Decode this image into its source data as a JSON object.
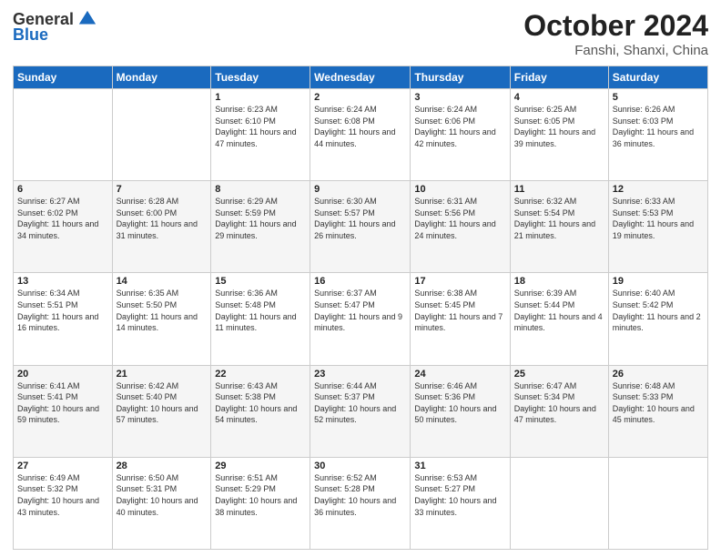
{
  "logo": {
    "general": "General",
    "blue": "Blue"
  },
  "header": {
    "title": "October 2024",
    "subtitle": "Fanshi, Shanxi, China"
  },
  "weekdays": [
    "Sunday",
    "Monday",
    "Tuesday",
    "Wednesday",
    "Thursday",
    "Friday",
    "Saturday"
  ],
  "weeks": [
    [
      null,
      null,
      {
        "day": "1",
        "sunrise": "Sunrise: 6:23 AM",
        "sunset": "Sunset: 6:10 PM",
        "daylight": "Daylight: 11 hours and 47 minutes."
      },
      {
        "day": "2",
        "sunrise": "Sunrise: 6:24 AM",
        "sunset": "Sunset: 6:08 PM",
        "daylight": "Daylight: 11 hours and 44 minutes."
      },
      {
        "day": "3",
        "sunrise": "Sunrise: 6:24 AM",
        "sunset": "Sunset: 6:06 PM",
        "daylight": "Daylight: 11 hours and 42 minutes."
      },
      {
        "day": "4",
        "sunrise": "Sunrise: 6:25 AM",
        "sunset": "Sunset: 6:05 PM",
        "daylight": "Daylight: 11 hours and 39 minutes."
      },
      {
        "day": "5",
        "sunrise": "Sunrise: 6:26 AM",
        "sunset": "Sunset: 6:03 PM",
        "daylight": "Daylight: 11 hours and 36 minutes."
      }
    ],
    [
      {
        "day": "6",
        "sunrise": "Sunrise: 6:27 AM",
        "sunset": "Sunset: 6:02 PM",
        "daylight": "Daylight: 11 hours and 34 minutes."
      },
      {
        "day": "7",
        "sunrise": "Sunrise: 6:28 AM",
        "sunset": "Sunset: 6:00 PM",
        "daylight": "Daylight: 11 hours and 31 minutes."
      },
      {
        "day": "8",
        "sunrise": "Sunrise: 6:29 AM",
        "sunset": "Sunset: 5:59 PM",
        "daylight": "Daylight: 11 hours and 29 minutes."
      },
      {
        "day": "9",
        "sunrise": "Sunrise: 6:30 AM",
        "sunset": "Sunset: 5:57 PM",
        "daylight": "Daylight: 11 hours and 26 minutes."
      },
      {
        "day": "10",
        "sunrise": "Sunrise: 6:31 AM",
        "sunset": "Sunset: 5:56 PM",
        "daylight": "Daylight: 11 hours and 24 minutes."
      },
      {
        "day": "11",
        "sunrise": "Sunrise: 6:32 AM",
        "sunset": "Sunset: 5:54 PM",
        "daylight": "Daylight: 11 hours and 21 minutes."
      },
      {
        "day": "12",
        "sunrise": "Sunrise: 6:33 AM",
        "sunset": "Sunset: 5:53 PM",
        "daylight": "Daylight: 11 hours and 19 minutes."
      }
    ],
    [
      {
        "day": "13",
        "sunrise": "Sunrise: 6:34 AM",
        "sunset": "Sunset: 5:51 PM",
        "daylight": "Daylight: 11 hours and 16 minutes."
      },
      {
        "day": "14",
        "sunrise": "Sunrise: 6:35 AM",
        "sunset": "Sunset: 5:50 PM",
        "daylight": "Daylight: 11 hours and 14 minutes."
      },
      {
        "day": "15",
        "sunrise": "Sunrise: 6:36 AM",
        "sunset": "Sunset: 5:48 PM",
        "daylight": "Daylight: 11 hours and 11 minutes."
      },
      {
        "day": "16",
        "sunrise": "Sunrise: 6:37 AM",
        "sunset": "Sunset: 5:47 PM",
        "daylight": "Daylight: 11 hours and 9 minutes."
      },
      {
        "day": "17",
        "sunrise": "Sunrise: 6:38 AM",
        "sunset": "Sunset: 5:45 PM",
        "daylight": "Daylight: 11 hours and 7 minutes."
      },
      {
        "day": "18",
        "sunrise": "Sunrise: 6:39 AM",
        "sunset": "Sunset: 5:44 PM",
        "daylight": "Daylight: 11 hours and 4 minutes."
      },
      {
        "day": "19",
        "sunrise": "Sunrise: 6:40 AM",
        "sunset": "Sunset: 5:42 PM",
        "daylight": "Daylight: 11 hours and 2 minutes."
      }
    ],
    [
      {
        "day": "20",
        "sunrise": "Sunrise: 6:41 AM",
        "sunset": "Sunset: 5:41 PM",
        "daylight": "Daylight: 10 hours and 59 minutes."
      },
      {
        "day": "21",
        "sunrise": "Sunrise: 6:42 AM",
        "sunset": "Sunset: 5:40 PM",
        "daylight": "Daylight: 10 hours and 57 minutes."
      },
      {
        "day": "22",
        "sunrise": "Sunrise: 6:43 AM",
        "sunset": "Sunset: 5:38 PM",
        "daylight": "Daylight: 10 hours and 54 minutes."
      },
      {
        "day": "23",
        "sunrise": "Sunrise: 6:44 AM",
        "sunset": "Sunset: 5:37 PM",
        "daylight": "Daylight: 10 hours and 52 minutes."
      },
      {
        "day": "24",
        "sunrise": "Sunrise: 6:46 AM",
        "sunset": "Sunset: 5:36 PM",
        "daylight": "Daylight: 10 hours and 50 minutes."
      },
      {
        "day": "25",
        "sunrise": "Sunrise: 6:47 AM",
        "sunset": "Sunset: 5:34 PM",
        "daylight": "Daylight: 10 hours and 47 minutes."
      },
      {
        "day": "26",
        "sunrise": "Sunrise: 6:48 AM",
        "sunset": "Sunset: 5:33 PM",
        "daylight": "Daylight: 10 hours and 45 minutes."
      }
    ],
    [
      {
        "day": "27",
        "sunrise": "Sunrise: 6:49 AM",
        "sunset": "Sunset: 5:32 PM",
        "daylight": "Daylight: 10 hours and 43 minutes."
      },
      {
        "day": "28",
        "sunrise": "Sunrise: 6:50 AM",
        "sunset": "Sunset: 5:31 PM",
        "daylight": "Daylight: 10 hours and 40 minutes."
      },
      {
        "day": "29",
        "sunrise": "Sunrise: 6:51 AM",
        "sunset": "Sunset: 5:29 PM",
        "daylight": "Daylight: 10 hours and 38 minutes."
      },
      {
        "day": "30",
        "sunrise": "Sunrise: 6:52 AM",
        "sunset": "Sunset: 5:28 PM",
        "daylight": "Daylight: 10 hours and 36 minutes."
      },
      {
        "day": "31",
        "sunrise": "Sunrise: 6:53 AM",
        "sunset": "Sunset: 5:27 PM",
        "daylight": "Daylight: 10 hours and 33 minutes."
      },
      null,
      null
    ]
  ]
}
